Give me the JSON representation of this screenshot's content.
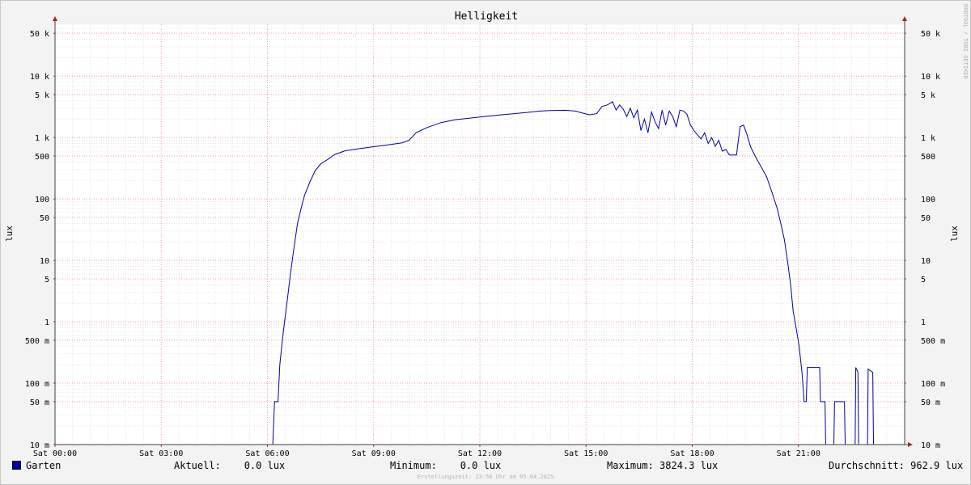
{
  "chart_data": {
    "type": "line",
    "title": "Helligkeit",
    "ylabel": "lux",
    "yscale": "log",
    "ylim": [
      0.01,
      70000
    ],
    "xlim": [
      "Sat 00:00",
      "Sat 24:00"
    ],
    "x_ticks": [
      "Sat 00:00",
      "Sat 03:00",
      "Sat 06:00",
      "Sat 09:00",
      "Sat 12:00",
      "Sat 15:00",
      "Sat 18:00",
      "Sat 21:00"
    ],
    "y_ticks": [
      {
        "value": 50000,
        "label": "50 k"
      },
      {
        "value": 10000,
        "label": "10 k"
      },
      {
        "value": 5000,
        "label": "5 k"
      },
      {
        "value": 1000,
        "label": "1 k"
      },
      {
        "value": 500,
        "label": "500"
      },
      {
        "value": 100,
        "label": "100"
      },
      {
        "value": 50,
        "label": "50"
      },
      {
        "value": 10,
        "label": "10"
      },
      {
        "value": 5,
        "label": "5"
      },
      {
        "value": 1,
        "label": "1"
      },
      {
        "value": 0.5,
        "label": "500 m"
      },
      {
        "value": 0.1,
        "label": "100 m"
      },
      {
        "value": 0.05,
        "label": "50 m"
      },
      {
        "value": 0.01,
        "label": "10 m"
      }
    ],
    "grid": true,
    "series": [
      {
        "name": "Garten",
        "color": "#0000a0",
        "x_unit": "hours",
        "points": [
          [
            0.0,
            0.01
          ],
          [
            6.15,
            0.01
          ],
          [
            6.2,
            0.05
          ],
          [
            6.3,
            0.05
          ],
          [
            6.35,
            0.2
          ],
          [
            6.45,
            0.7
          ],
          [
            6.55,
            2
          ],
          [
            6.65,
            6
          ],
          [
            6.75,
            16
          ],
          [
            6.85,
            40
          ],
          [
            6.95,
            70
          ],
          [
            7.05,
            115
          ],
          [
            7.2,
            190
          ],
          [
            7.35,
            290
          ],
          [
            7.5,
            370
          ],
          [
            7.7,
            440
          ],
          [
            7.9,
            530
          ],
          [
            8.2,
            610
          ],
          [
            8.6,
            660
          ],
          [
            9.0,
            710
          ],
          [
            9.4,
            760
          ],
          [
            9.8,
            820
          ],
          [
            10.0,
            900
          ],
          [
            10.2,
            1200
          ],
          [
            10.5,
            1450
          ],
          [
            10.9,
            1750
          ],
          [
            11.3,
            1950
          ],
          [
            11.8,
            2100
          ],
          [
            12.3,
            2250
          ],
          [
            12.8,
            2400
          ],
          [
            13.3,
            2550
          ],
          [
            13.7,
            2700
          ],
          [
            14.0,
            2750
          ],
          [
            14.4,
            2780
          ],
          [
            14.7,
            2700
          ],
          [
            14.9,
            2500
          ],
          [
            15.1,
            2350
          ],
          [
            15.3,
            2450
          ],
          [
            15.45,
            3200
          ],
          [
            15.6,
            3400
          ],
          [
            15.75,
            3824
          ],
          [
            15.85,
            2800
          ],
          [
            15.95,
            3400
          ],
          [
            16.05,
            2900
          ],
          [
            16.15,
            2200
          ],
          [
            16.25,
            3000
          ],
          [
            16.35,
            2100
          ],
          [
            16.45,
            2800
          ],
          [
            16.55,
            1300
          ],
          [
            16.65,
            2000
          ],
          [
            16.75,
            1200
          ],
          [
            16.85,
            2600
          ],
          [
            16.95,
            1800
          ],
          [
            17.05,
            1400
          ],
          [
            17.15,
            2800
          ],
          [
            17.25,
            1600
          ],
          [
            17.35,
            2700
          ],
          [
            17.45,
            2200
          ],
          [
            17.55,
            1500
          ],
          [
            17.65,
            2800
          ],
          [
            17.75,
            2700
          ],
          [
            17.85,
            2400
          ],
          [
            17.95,
            1600
          ],
          [
            18.05,
            1300
          ],
          [
            18.15,
            1100
          ],
          [
            18.25,
            950
          ],
          [
            18.35,
            1200
          ],
          [
            18.45,
            800
          ],
          [
            18.55,
            1000
          ],
          [
            18.65,
            720
          ],
          [
            18.75,
            900
          ],
          [
            18.85,
            600
          ],
          [
            18.95,
            640
          ],
          [
            19.05,
            520
          ],
          [
            19.25,
            520
          ],
          [
            19.35,
            1500
          ],
          [
            19.45,
            1600
          ],
          [
            19.55,
            1100
          ],
          [
            19.65,
            700
          ],
          [
            19.8,
            470
          ],
          [
            19.95,
            330
          ],
          [
            20.1,
            230
          ],
          [
            20.25,
            130
          ],
          [
            20.4,
            70
          ],
          [
            20.5,
            40
          ],
          [
            20.6,
            22
          ],
          [
            20.7,
            9
          ],
          [
            20.78,
            4
          ],
          [
            20.85,
            1.5
          ],
          [
            20.95,
            0.7
          ],
          [
            21.02,
            0.4
          ],
          [
            21.1,
            0.15
          ],
          [
            21.16,
            0.05
          ],
          [
            21.22,
            0.05
          ],
          [
            21.25,
            0.18
          ],
          [
            21.6,
            0.18
          ],
          [
            21.62,
            0.05
          ],
          [
            21.75,
            0.05
          ],
          [
            21.77,
            0.01
          ],
          [
            22.0,
            0.01
          ],
          [
            22.02,
            0.05
          ],
          [
            22.3,
            0.05
          ],
          [
            22.32,
            0.01
          ],
          [
            22.6,
            0.01
          ],
          [
            22.62,
            0.18
          ],
          [
            22.68,
            0.15
          ],
          [
            22.7,
            0.01
          ],
          [
            22.95,
            0.01
          ],
          [
            22.97,
            0.17
          ],
          [
            23.1,
            0.15
          ],
          [
            23.12,
            0.01
          ],
          [
            24.0,
            0.01
          ]
        ]
      }
    ]
  },
  "legend": {
    "series_name": "Garten",
    "aktuell": "Aktuell:    0.0 lux",
    "minimum": "Minimum:    0.0 lux",
    "maximum": "Maximum: 3824.3 lux",
    "durchschnitt": "Durchschnitt: 962.9 lux"
  },
  "watermark": "RRDTOOL / TOBI OETIKER",
  "footer": "Erstellungszeit: 23:58 Uhr am 05.04.2025"
}
